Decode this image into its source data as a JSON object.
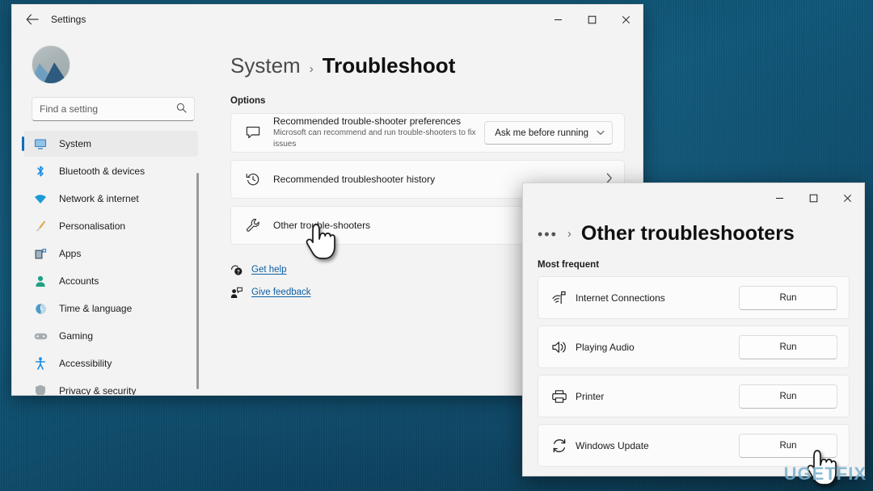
{
  "desktop": {
    "wallpaper_color": "#0f5170"
  },
  "settings_window": {
    "titlebar": {
      "back_label": "←",
      "title": "Settings",
      "minimize": "–",
      "maximize": "☐",
      "close": "✕"
    },
    "search": {
      "placeholder": "Find a setting",
      "icon": "search-icon",
      "value": ""
    },
    "sidebar": {
      "items": [
        {
          "label": "System",
          "icon": "▣",
          "color": "#2a72b8",
          "active": true
        },
        {
          "label": "Bluetooth & devices",
          "icon": "ᛗ",
          "color": "#1b8ce3",
          "active": false
        },
        {
          "label": "Network & internet",
          "icon": "▼",
          "color": "#1b9bd8",
          "active": false
        },
        {
          "label": "Personalisation",
          "icon": "╱",
          "color": "#d99b3a",
          "active": false
        },
        {
          "label": "Apps",
          "icon": "▤",
          "color": "#2a72b8",
          "active": false
        },
        {
          "label": "Accounts",
          "icon": "●",
          "color": "#23a186",
          "active": false
        },
        {
          "label": "Time & language",
          "icon": "◔",
          "color": "#3b8fc4",
          "active": false
        },
        {
          "label": "Gaming",
          "icon": "▬",
          "color": "#8d8d8d",
          "active": false
        },
        {
          "label": "Accessibility",
          "icon": "✹",
          "color": "#1b8ce3",
          "active": false
        },
        {
          "label": "Privacy & security",
          "icon": "▼",
          "color": "#9aa0a3",
          "active": false
        }
      ]
    },
    "main": {
      "breadcrumb": {
        "root": "System",
        "separator": "›",
        "leaf": "Troubleshoot"
      },
      "section_title": "Options",
      "options": [
        {
          "title": "Recommended trouble-shooter preferences",
          "subtitle": "Microsoft can recommend and run trouble-shooters to fix issues",
          "icon": "speech-bubble-icon",
          "icon_glyph": "⬜",
          "control": "dropdown",
          "dropdown_value": "Ask me before running",
          "dropdown_caret": "⌄"
        },
        {
          "title": "Recommended troubleshooter history",
          "subtitle": "",
          "icon": "history-icon",
          "icon_glyph": "↺",
          "control": "chevron",
          "chevron": "›"
        },
        {
          "title": "Other trouble-shooters",
          "subtitle": "",
          "icon": "wrench-icon",
          "icon_glyph": "⚒",
          "control": "none",
          "chevron": ""
        }
      ],
      "links": [
        {
          "label": "Get help",
          "icon": "help-icon",
          "glyph": "❔"
        },
        {
          "label": "Give feedback",
          "icon": "feedback-icon",
          "glyph": "⚑"
        }
      ]
    }
  },
  "troubleshooters_window": {
    "titlebar": {
      "minimize": "–",
      "maximize": "☐",
      "close": "✕"
    },
    "breadcrumb": {
      "dots": "•••",
      "separator": "›",
      "leaf": "Other troubleshooters"
    },
    "section_title": "Most frequent",
    "rows": [
      {
        "name": "Internet Connections",
        "icon": "wifi-icon",
        "glyph": "὏6",
        "button": "Run"
      },
      {
        "name": "Playing Audio",
        "icon": "speaker-icon",
        "glyph": "ὐA",
        "button": "Run"
      },
      {
        "name": "Printer",
        "icon": "printer-icon",
        "glyph": "⎙",
        "button": "Run"
      },
      {
        "name": "Windows Update",
        "icon": "refresh-icon",
        "glyph": "↻",
        "button": "Run"
      }
    ]
  },
  "watermark": {
    "text": "UGETFIX"
  }
}
